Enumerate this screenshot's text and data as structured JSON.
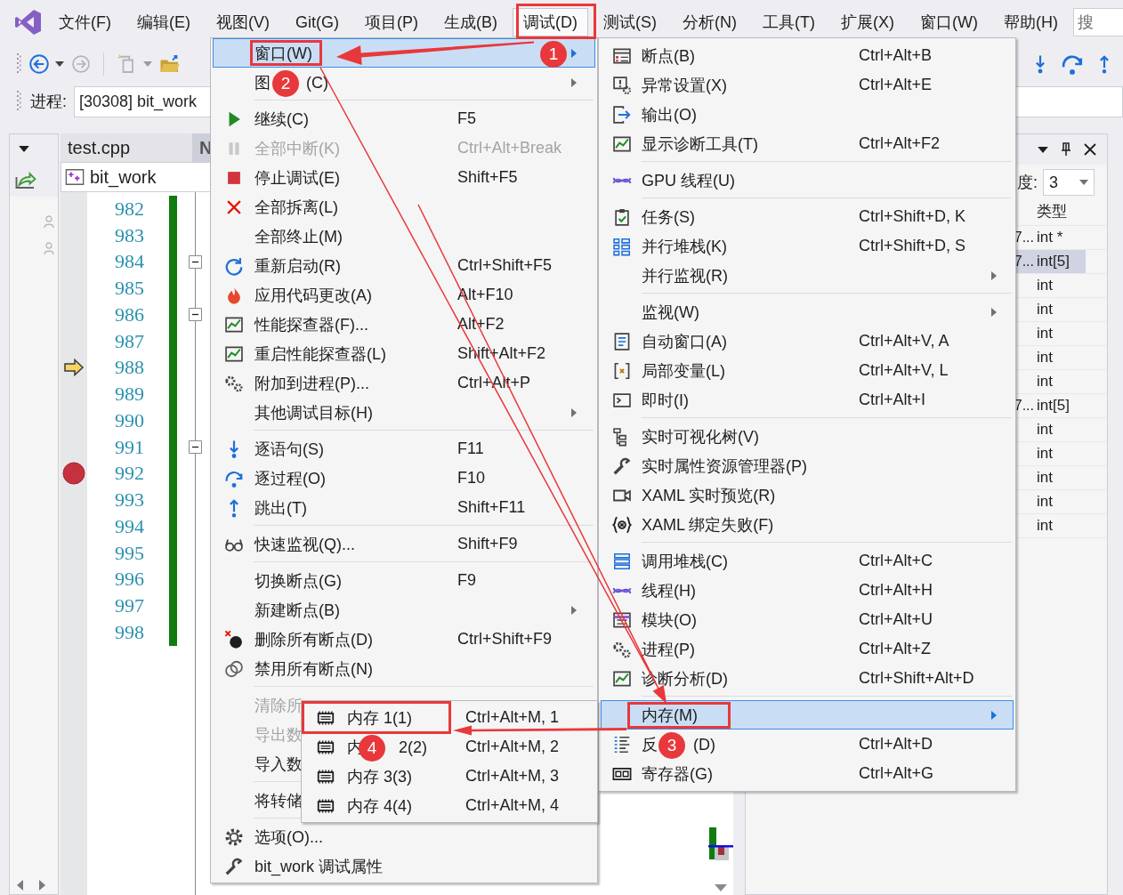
{
  "menubar": {
    "items": [
      {
        "label": "文件(F)",
        "selected": false
      },
      {
        "label": "编辑(E)",
        "selected": false
      },
      {
        "label": "视图(V)",
        "selected": false
      },
      {
        "label": "Git(G)",
        "selected": false
      },
      {
        "label": "项目(P)",
        "selected": false
      },
      {
        "label": "生成(B)",
        "selected": false
      },
      {
        "label": "调试(D)",
        "selected": true
      },
      {
        "label": "测试(S)",
        "selected": false
      },
      {
        "label": "分析(N)",
        "selected": false
      },
      {
        "label": "工具(T)",
        "selected": false
      },
      {
        "label": "扩展(X)",
        "selected": false
      },
      {
        "label": "窗口(W)",
        "selected": false
      },
      {
        "label": "帮助(H)",
        "selected": false
      }
    ],
    "search": {
      "placeholder": "搜"
    }
  },
  "process": {
    "label": "进程:",
    "value": "[30308] bit_work"
  },
  "editor": {
    "tabs": [
      {
        "label": "test.cpp",
        "selected": true
      },
      {
        "label": "N",
        "selected": false
      }
    ],
    "navigation": "bit_work",
    "lines": [
      {
        "number": "982",
        "current": false,
        "breakpoint": false,
        "fold": false
      },
      {
        "number": "983",
        "current": false,
        "breakpoint": false,
        "fold": false
      },
      {
        "number": "984",
        "current": false,
        "breakpoint": false,
        "fold": true
      },
      {
        "number": "985",
        "current": false,
        "breakpoint": false,
        "fold": false
      },
      {
        "number": "986",
        "current": false,
        "breakpoint": false,
        "fold": true
      },
      {
        "number": "987",
        "current": false,
        "breakpoint": false,
        "fold": false
      },
      {
        "number": "988",
        "current": true,
        "breakpoint": false,
        "fold": false
      },
      {
        "number": "989",
        "current": false,
        "breakpoint": false,
        "fold": false
      },
      {
        "number": "990",
        "current": false,
        "breakpoint": false,
        "fold": false
      },
      {
        "number": "991",
        "current": false,
        "breakpoint": false,
        "fold": true
      },
      {
        "number": "992",
        "current": false,
        "breakpoint": true,
        "fold": false
      },
      {
        "number": "993",
        "current": false,
        "breakpoint": false,
        "fold": false
      },
      {
        "number": "994",
        "current": false,
        "breakpoint": false,
        "fold": false
      },
      {
        "number": "995",
        "current": false,
        "breakpoint": false,
        "fold": false
      },
      {
        "number": "996",
        "current": false,
        "breakpoint": false,
        "fold": false
      },
      {
        "number": "997",
        "current": false,
        "breakpoint": false,
        "fold": false
      },
      {
        "number": "998",
        "current": false,
        "breakpoint": false,
        "fold": false
      }
    ]
  },
  "watch": {
    "depth_label": "度:",
    "depth_value": "3",
    "columns": [
      "类型"
    ],
    "rows": [
      {
        "column_1": "7...",
        "type": "int *",
        "selected": false
      },
      {
        "column_1": "7...",
        "type": "int[5]",
        "selected": true
      },
      {
        "type": "int",
        "selected": false
      },
      {
        "type": "int",
        "selected": false
      },
      {
        "type": "int",
        "selected": false
      },
      {
        "type": "int",
        "selected": false
      },
      {
        "type": "int",
        "selected": false
      },
      {
        "column_1": "7...",
        "type": "int[5]",
        "selected": false
      },
      {
        "type": "int",
        "selected": false
      },
      {
        "type": "int",
        "selected": false
      },
      {
        "type": "int",
        "selected": false
      },
      {
        "type": "int",
        "selected": false
      },
      {
        "type": "int",
        "selected": false
      }
    ]
  },
  "debug_menu": {
    "items": [
      {
        "kind": "item",
        "label": "窗口(W)",
        "disabled": false,
        "selected": true,
        "submenu": true
      },
      {
        "kind": "item",
        "label": "图",
        "label_end": "(C)",
        "disabled": false,
        "selected": false,
        "submenu": true
      },
      {
        "kind": "separator"
      },
      {
        "kind": "item",
        "label": "继续(C)",
        "shortcut": "F5",
        "disabled": false,
        "selected": false,
        "submenu": false
      },
      {
        "kind": "item",
        "label": "全部中断(K)",
        "shortcut": "Ctrl+Alt+Break",
        "disabled": true,
        "selected": false,
        "submenu": false
      },
      {
        "kind": "item",
        "label": "停止调试(E)",
        "shortcut": "Shift+F5",
        "disabled": false,
        "selected": false,
        "submenu": false
      },
      {
        "kind": "item",
        "label": "全部拆离(L)",
        "disabled": false,
        "selected": false,
        "submenu": false
      },
      {
        "kind": "item",
        "label": "全部终止(M)",
        "disabled": false,
        "selected": false,
        "submenu": false
      },
      {
        "kind": "item",
        "label": "重新启动(R)",
        "shortcut": "Ctrl+Shift+F5",
        "disabled": false,
        "selected": false,
        "submenu": false
      },
      {
        "kind": "item",
        "label": "应用代码更改(A)",
        "shortcut": "Alt+F10",
        "disabled": false,
        "selected": false,
        "submenu": false
      },
      {
        "kind": "item",
        "label": "性能探查器(F)...",
        "shortcut": "Alt+F2",
        "disabled": false,
        "selected": false,
        "submenu": false
      },
      {
        "kind": "item",
        "label": "重启性能探查器(L)",
        "shortcut": "Shift+Alt+F2",
        "disabled": false,
        "selected": false,
        "submenu": false
      },
      {
        "kind": "item",
        "label": "附加到进程(P)...",
        "shortcut": "Ctrl+Alt+P",
        "disabled": false,
        "selected": false,
        "submenu": false
      },
      {
        "kind": "item",
        "label": "其他调试目标(H)",
        "disabled": false,
        "selected": false,
        "submenu": true
      },
      {
        "kind": "separator"
      },
      {
        "kind": "item",
        "label": "逐语句(S)",
        "shortcut": "F11",
        "disabled": false,
        "selected": false,
        "submenu": false
      },
      {
        "kind": "item",
        "label": "逐过程(O)",
        "shortcut": "F10",
        "disabled": false,
        "selected": false,
        "submenu": false
      },
      {
        "kind": "item",
        "label": "跳出(T)",
        "shortcut": "Shift+F11",
        "disabled": false,
        "selected": false,
        "submenu": false
      },
      {
        "kind": "separator"
      },
      {
        "kind": "item",
        "label": "快速监视(Q)...",
        "shortcut": "Shift+F9",
        "disabled": false,
        "selected": false,
        "submenu": false
      },
      {
        "kind": "separator"
      },
      {
        "kind": "item",
        "label": "切换断点(G)",
        "shortcut": "F9",
        "disabled": false,
        "selected": false,
        "submenu": false
      },
      {
        "kind": "item",
        "label": "新建断点(B)",
        "disabled": false,
        "selected": false,
        "submenu": true
      },
      {
        "kind": "item",
        "label": "删除所有断点(D)",
        "shortcut": "Ctrl+Shift+F9",
        "disabled": false,
        "selected": false,
        "submenu": false
      },
      {
        "kind": "item",
        "label": "禁用所有断点(N)",
        "disabled": false,
        "selected": false,
        "submenu": false
      },
      {
        "kind": "separator"
      },
      {
        "kind": "item",
        "label": "清除所",
        "disabled": true,
        "selected": false
      },
      {
        "kind": "item",
        "label": "导出数",
        "disabled": true,
        "selected": false
      },
      {
        "kind": "item",
        "label": "导入数",
        "disabled": false,
        "selected": false
      },
      {
        "kind": "separator"
      },
      {
        "kind": "item",
        "label": "将转储",
        "disabled": false,
        "selected": false
      },
      {
        "kind": "separator"
      },
      {
        "kind": "item",
        "label": "选项(O)...",
        "disabled": false,
        "selected": false,
        "submenu": false
      },
      {
        "kind": "item",
        "label": "bit_work 调试属性",
        "disabled": false,
        "selected": false,
        "submenu": false
      }
    ]
  },
  "window_submenu": {
    "items": [
      {
        "kind": "item",
        "label": "断点(B)",
        "shortcut": "Ctrl+Alt+B",
        "selected": false,
        "submenu": false
      },
      {
        "kind": "item",
        "label": "异常设置(X)",
        "shortcut": "Ctrl+Alt+E",
        "selected": false,
        "submenu": false
      },
      {
        "kind": "item",
        "label": "输出(O)",
        "selected": false,
        "submenu": false
      },
      {
        "kind": "item",
        "label": "显示诊断工具(T)",
        "shortcut": "Ctrl+Alt+F2",
        "selected": false,
        "submenu": false
      },
      {
        "kind": "separator"
      },
      {
        "kind": "item",
        "label": "GPU 线程(U)",
        "selected": false,
        "submenu": false
      },
      {
        "kind": "separator"
      },
      {
        "kind": "item",
        "label": "任务(S)",
        "shortcut": "Ctrl+Shift+D, K",
        "selected": false,
        "submenu": false
      },
      {
        "kind": "item",
        "label": "并行堆栈(K)",
        "shortcut": "Ctrl+Shift+D, S",
        "selected": false,
        "submenu": false
      },
      {
        "kind": "item",
        "label": "并行监视(R)",
        "selected": false,
        "submenu": true
      },
      {
        "kind": "separator"
      },
      {
        "kind": "item",
        "label": "监视(W)",
        "selected": false,
        "submenu": true
      },
      {
        "kind": "item",
        "label": "自动窗口(A)",
        "shortcut": "Ctrl+Alt+V, A",
        "selected": false,
        "submenu": false
      },
      {
        "kind": "item",
        "label": "局部变量(L)",
        "shortcut": "Ctrl+Alt+V, L",
        "selected": false,
        "submenu": false
      },
      {
        "kind": "item",
        "label": "即时(I)",
        "shortcut": "Ctrl+Alt+I",
        "selected": false,
        "submenu": false
      },
      {
        "kind": "separator"
      },
      {
        "kind": "item",
        "label": "实时可视化树(V)",
        "selected": false,
        "submenu": false
      },
      {
        "kind": "item",
        "label": "实时属性资源管理器(P)",
        "selected": false,
        "submenu": false
      },
      {
        "kind": "item",
        "label": "XAML 实时预览(R)",
        "selected": false,
        "submenu": false
      },
      {
        "kind": "item",
        "label": "XAML 绑定失败(F)",
        "selected": false,
        "submenu": false
      },
      {
        "kind": "separator"
      },
      {
        "kind": "item",
        "label": "调用堆栈(C)",
        "shortcut": "Ctrl+Alt+C",
        "selected": false,
        "submenu": false
      },
      {
        "kind": "item",
        "label": "线程(H)",
        "shortcut": "Ctrl+Alt+H",
        "selected": false,
        "submenu": false
      },
      {
        "kind": "item",
        "label": "模块(O)",
        "shortcut": "Ctrl+Alt+U",
        "selected": false,
        "submenu": false
      },
      {
        "kind": "item",
        "label": "进程(P)",
        "shortcut": "Ctrl+Alt+Z",
        "selected": false,
        "submenu": false
      },
      {
        "kind": "item",
        "label": "诊断分析(D)",
        "shortcut": "Ctrl+Shift+Alt+D",
        "selected": false,
        "submenu": false
      },
      {
        "kind": "separator"
      },
      {
        "kind": "item",
        "label": "内存(M)",
        "selected": true,
        "submenu": true
      },
      {
        "kind": "item",
        "label": "反",
        "label_end": "(D)",
        "shortcut": "Ctrl+Alt+D",
        "selected": false,
        "submenu": false
      },
      {
        "kind": "item",
        "label": "寄存器(G)",
        "shortcut": "Ctrl+Alt+G",
        "selected": false,
        "submenu": false
      }
    ]
  },
  "memory_submenu": {
    "items": [
      {
        "label": "内存 1(1)",
        "shortcut": "Ctrl+Alt+M, 1",
        "selected": false
      },
      {
        "label": "内",
        "label_end": "2(2)",
        "shortcut": "Ctrl+Alt+M, 2",
        "selected": false
      },
      {
        "label": "内存 3(3)",
        "shortcut": "Ctrl+Alt+M, 3",
        "selected": false
      },
      {
        "label": "内存 4(4)",
        "shortcut": "Ctrl+Alt+M, 4",
        "selected": false
      }
    ]
  },
  "annotations": {
    "markers": [
      "1",
      "2",
      "3",
      "4"
    ]
  }
}
